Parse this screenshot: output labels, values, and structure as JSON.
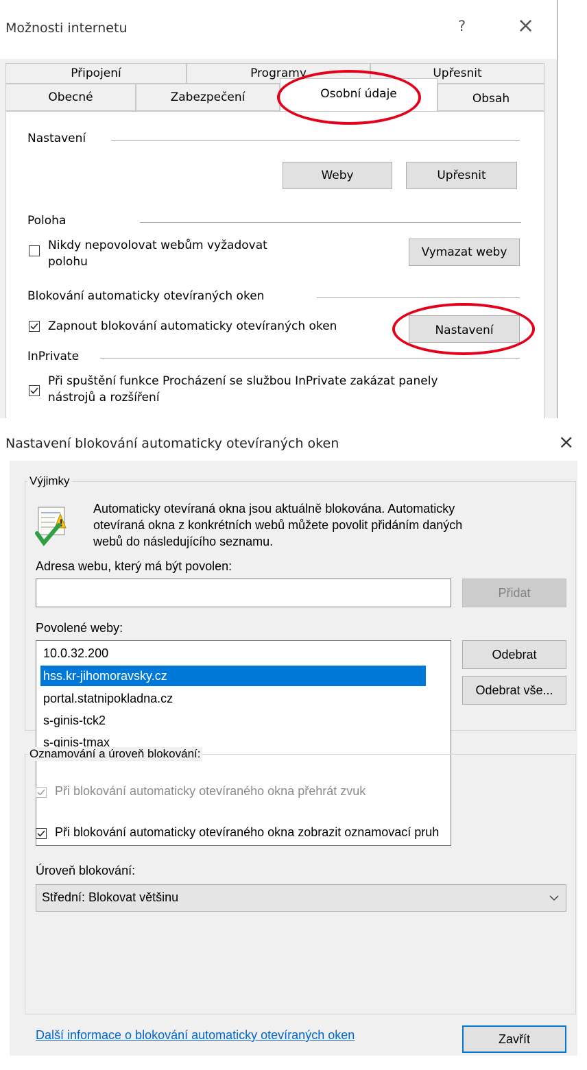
{
  "top_dialog": {
    "title": "Možnosti internetu",
    "help_glyph": "?",
    "close_glyph": "×",
    "tabs_row1": [
      "Připojení",
      "Programy",
      "Upřesnit"
    ],
    "tabs_row2": [
      "Obecné",
      "Zabezpečení",
      "Osobní údaje",
      "Obsah"
    ],
    "active_tab": "Osobní údaje",
    "settings_label": "Nastavení",
    "sites_button": "Weby",
    "advanced_button": "Upřesnit",
    "location_label": "Poloha",
    "location_check_line1": "Nikdy nepovolovat webům vyžadovat",
    "location_check_line2": "polohu",
    "location_checked": false,
    "clear_sites_button": "Vymazat weby",
    "popup_label": "Blokování automaticky otevíraných oken",
    "popup_check": "Zapnout blokování automaticky otevíraných oken",
    "popup_checked": true,
    "popup_settings_button": "Nastavení",
    "inprivate_label": "InPrivate",
    "inprivate_check_line1": "Při spuštění funkce Procházení se službou InPrivate zakázat panely",
    "inprivate_check_line2": "nástrojů a rozšíření",
    "inprivate_checked": true
  },
  "popup_dialog": {
    "title": "Nastavení blokování automaticky otevíraných oken",
    "close_glyph": "×",
    "exceptions_label": "Výjimky",
    "info_line1": "Automaticky otevíraná okna jsou aktuálně blokována. Automaticky",
    "info_line2": "otevíraná okna z konkrétních webů můžete povolit přidáním daných",
    "info_line3": "webů do následujícího seznamu.",
    "address_label": "Adresa webu, který má být povolen:",
    "address_value": "",
    "add_button": "Přidat",
    "allowed_label": "Povolené weby:",
    "allowed_sites": [
      "10.0.32.200",
      "hss.kr-jihomoravsky.cz",
      "portal.statnipokladna.cz",
      "s-ginis-tck2",
      "s-ginis-tmax"
    ],
    "selected_site": "hss.kr-jihomoravsky.cz",
    "remove_button": "Odebrat",
    "remove_all_button": "Odebrat vše...",
    "notifications_label": "Oznamování a úroveň blokování:",
    "sound_check": "Při blokování automaticky otevíraného okna přehrát zvuk",
    "sound_checked": true,
    "sound_disabled": true,
    "bar_check": "Při blokování automaticky otevíraného okna zobrazit oznamovací pruh",
    "bar_checked": true,
    "level_label": "Úroveň blokování:",
    "level_value": "Střední: Blokovat většinu",
    "more_info_link": "Další informace o blokování automaticky otevíraných oken",
    "close_button": "Zavřít"
  },
  "colors": {
    "highlight": "#e3001b",
    "selection": "#0078d7",
    "link": "#0066cc"
  }
}
